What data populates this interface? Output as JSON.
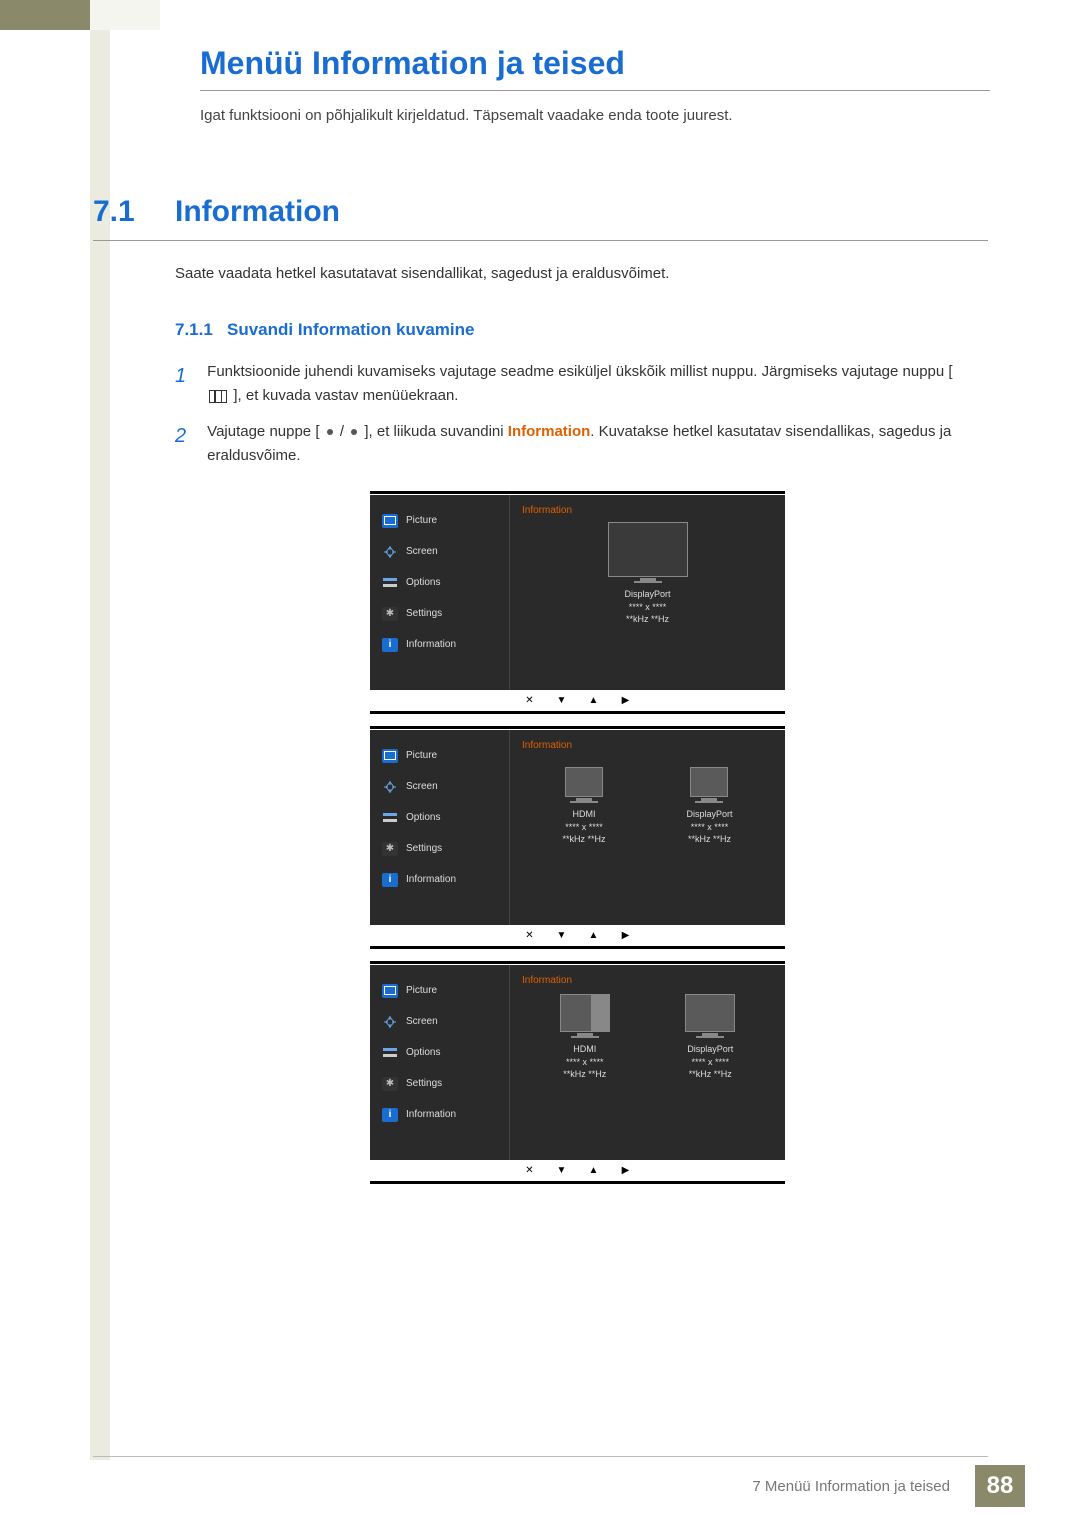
{
  "page": {
    "title": "Menüü Information ja teised",
    "intro": "Igat funktsiooni on põhjalikult kirjeldatud. Täpsemalt vaadake enda toote juurest."
  },
  "section": {
    "number": "7.1",
    "title": "Information",
    "text": "Saate vaadata hetkel kasutatavat sisendallikat, sagedust ja eraldusvõimet."
  },
  "subsection": {
    "number": "7.1.1",
    "title": "Suvandi Information kuvamine"
  },
  "steps": {
    "s1": "Funktsioonide juhendi kuvamiseks vajutage seadme esiküljel ükskõik millist nuppu. Järgmiseks vajutage nuppu [",
    "s1b": "], et kuvada vastav menüüekraan.",
    "s2a": "Vajutage nuppe [",
    "s2mid": "], et liikuda suvandini ",
    "s2hl": "Information",
    "s2b": ". Kuvatakse hetkel kasutatav sisendallikas, sagedus ja eraldusvõime."
  },
  "osd": {
    "menu": {
      "picture": "Picture",
      "screen": "Screen",
      "options": "Options",
      "settings": "Settings",
      "information": "Information"
    },
    "header": "Information",
    "labels": {
      "displayport": "DisplayPort",
      "hdmi": "HDMI",
      "res": "**** x ****",
      "freq": "**kHz **Hz"
    },
    "buttons": {
      "close": "✕",
      "down": "▼",
      "up": "▲",
      "right": "▶"
    }
  },
  "footer": {
    "chapter": "7 Menüü Information ja teised",
    "page": "88"
  }
}
